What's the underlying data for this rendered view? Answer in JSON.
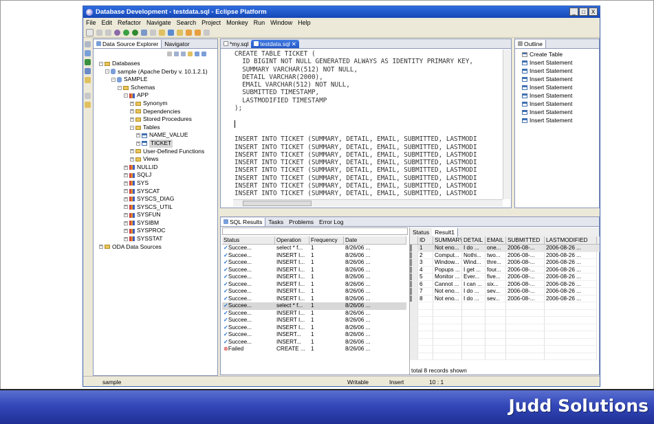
{
  "window": {
    "title": "Database Development - testdata.sql - Eclipse Platform",
    "minimize": "_",
    "maximize": "□",
    "close": "X"
  },
  "menu": [
    "File",
    "Edit",
    "Refactor",
    "Navigate",
    "Search",
    "Project",
    "Monkey",
    "Run",
    "Window",
    "Help"
  ],
  "explorer": {
    "tabs": [
      "Data Source Explorer",
      "Navigator"
    ],
    "nodes": [
      {
        "label": "Databases",
        "level": 0,
        "exp": "-",
        "icon": "folder"
      },
      {
        "label": "sample (Apache Derby v. 10.1.2.1)",
        "level": 1,
        "exp": "-",
        "icon": "db"
      },
      {
        "label": "SAMPLE",
        "level": 2,
        "exp": "-",
        "icon": "db"
      },
      {
        "label": "Schemas",
        "level": 3,
        "exp": "-",
        "icon": "folder"
      },
      {
        "label": "APP",
        "level": 4,
        "exp": "-",
        "icon": "schema"
      },
      {
        "label": "Synonym",
        "level": 5,
        "exp": "+",
        "icon": "folder"
      },
      {
        "label": "Dependencies",
        "level": 5,
        "exp": "+",
        "icon": "folder"
      },
      {
        "label": "Stored Procedures",
        "level": 5,
        "exp": "+",
        "icon": "folder"
      },
      {
        "label": "Tables",
        "level": 5,
        "exp": "-",
        "icon": "folder"
      },
      {
        "label": "NAME_VALUE",
        "level": 6,
        "exp": "+",
        "icon": "table"
      },
      {
        "label": "TICKET",
        "level": 6,
        "exp": "+",
        "icon": "table",
        "selected": true
      },
      {
        "label": "User-Defined Functions",
        "level": 5,
        "exp": "+",
        "icon": "folder"
      },
      {
        "label": "Views",
        "level": 5,
        "exp": "+",
        "icon": "folder"
      },
      {
        "label": "NULLID",
        "level": 4,
        "exp": "+",
        "icon": "schema"
      },
      {
        "label": "SQLJ",
        "level": 4,
        "exp": "+",
        "icon": "schema"
      },
      {
        "label": "SYS",
        "level": 4,
        "exp": "+",
        "icon": "schema"
      },
      {
        "label": "SYSCAT",
        "level": 4,
        "exp": "+",
        "icon": "schema"
      },
      {
        "label": "SYSCS_DIAG",
        "level": 4,
        "exp": "+",
        "icon": "schema"
      },
      {
        "label": "SYSCS_UTIL",
        "level": 4,
        "exp": "+",
        "icon": "schema"
      },
      {
        "label": "SYSFUN",
        "level": 4,
        "exp": "+",
        "icon": "schema"
      },
      {
        "label": "SYSIBM",
        "level": 4,
        "exp": "+",
        "icon": "schema"
      },
      {
        "label": "SYSPROC",
        "level": 4,
        "exp": "+",
        "icon": "schema"
      },
      {
        "label": "SYSSTAT",
        "level": 4,
        "exp": "+",
        "icon": "schema"
      },
      {
        "label": "ODA Data Sources",
        "level": 0,
        "exp": "+",
        "icon": "folder"
      }
    ]
  },
  "editor": {
    "tabs": [
      "*my.sql",
      "testdata.sql"
    ],
    "lines": [
      "CREATE TABLE TICKET (",
      "  ID BIGINT NOT NULL GENERATED ALWAYS AS IDENTITY PRIMARY KEY,",
      "  SUMMARY VARCHAR(512) NOT NULL,",
      "  DETAIL VARCHAR(2000),",
      "  EMAIL VARCHAR(512) NOT NULL,",
      "  SUBMITTED TIMESTAMP,",
      "  LASTMODIFIED TIMESTAMP",
      ");",
      "",
      "",
      "",
      "INSERT INTO TICKET (SUMMARY, DETAIL, EMAIL, SUBMITTED, LASTMODI",
      "INSERT INTO TICKET (SUMMARY, DETAIL, EMAIL, SUBMITTED, LASTMODI",
      "INSERT INTO TICKET (SUMMARY, DETAIL, EMAIL, SUBMITTED, LASTMODI",
      "INSERT INTO TICKET (SUMMARY, DETAIL, EMAIL, SUBMITTED, LASTMODI",
      "INSERT INTO TICKET (SUMMARY, DETAIL, EMAIL, SUBMITTED, LASTMODI",
      "INSERT INTO TICKET (SUMMARY, DETAIL, EMAIL, SUBMITTED, LASTMODI",
      "INSERT INTO TICKET (SUMMARY, DETAIL, EMAIL, SUBMITTED, LASTMODI",
      "INSERT INTO TICKET (SUMMARY, DETAIL, EMAIL, SUBMITTED, LASTMODI"
    ]
  },
  "outline": {
    "tab": "Outline",
    "items": [
      "Create Table",
      "Insert Statement",
      "Insert Statement",
      "Insert Statement",
      "Insert Statement",
      "Insert Statement",
      "Insert Statement",
      "Insert Statement",
      "Insert Statement"
    ]
  },
  "sqlResults": {
    "tabs": [
      "SQL Results",
      "Tasks",
      "Problems",
      "Error Log"
    ],
    "columns": [
      "Status",
      "Operation",
      "Frequency",
      "Date"
    ],
    "rows": [
      {
        "status": "Succee...",
        "op": "select * f...",
        "freq": "1",
        "date": "8/26/06 ...",
        "ok": true
      },
      {
        "status": "Succee...",
        "op": "INSERT I...",
        "freq": "1",
        "date": "8/26/06 ...",
        "ok": true
      },
      {
        "status": "Succee...",
        "op": "INSERT I...",
        "freq": "1",
        "date": "8/26/06 ...",
        "ok": true
      },
      {
        "status": "Succee...",
        "op": "INSERT I...",
        "freq": "1",
        "date": "8/26/06 ...",
        "ok": true
      },
      {
        "status": "Succee...",
        "op": "INSERT I...",
        "freq": "1",
        "date": "8/26/06 ...",
        "ok": true
      },
      {
        "status": "Succee...",
        "op": "INSERT I...",
        "freq": "1",
        "date": "8/26/06 ...",
        "ok": true
      },
      {
        "status": "Succee...",
        "op": "INSERT I...",
        "freq": "1",
        "date": "8/26/06 ...",
        "ok": true
      },
      {
        "status": "Succee...",
        "op": "INSERT I...",
        "freq": "1",
        "date": "8/26/06 ...",
        "ok": true
      },
      {
        "status": "Succee...",
        "op": "select * f...",
        "freq": "1",
        "date": "8/26/06 ...",
        "ok": true,
        "selected": true
      },
      {
        "status": "Succee...",
        "op": "INSERT I...",
        "freq": "1",
        "date": "8/26/06 ...",
        "ok": true
      },
      {
        "status": "Succee...",
        "op": "INSERT I...",
        "freq": "1",
        "date": "8/26/06 ...",
        "ok": true
      },
      {
        "status": "Succee...",
        "op": "INSERT I...",
        "freq": "1",
        "date": "8/26/06 ...",
        "ok": true
      },
      {
        "status": "Succee...",
        "op": "INSERT...",
        "freq": "1",
        "date": "8/26/06 ...",
        "ok": true
      },
      {
        "status": "Succee...",
        "op": "INSERT...",
        "freq": "1",
        "date": "8/26/06 ...",
        "ok": true
      },
      {
        "status": "Failed",
        "op": "CREATE ...",
        "freq": "1",
        "date": "8/26/06 ...",
        "ok": false
      }
    ]
  },
  "result": {
    "tabs": [
      "Status",
      "Result1"
    ],
    "columns": [
      "ID",
      "SUMMARY",
      "DETAIL",
      "EMAIL",
      "SUBMITTED",
      "LASTMODIFIED"
    ],
    "rows": [
      [
        "1",
        "Not eno...",
        "I do ...",
        "one...",
        "2006-08-...",
        "2006-08-26 ..."
      ],
      [
        "2",
        "Comput...",
        "Nothi...",
        "two...",
        "2006-08-...",
        "2006-08-26 ..."
      ],
      [
        "3",
        "Window...",
        "Wind...",
        "thre...",
        "2006-08-...",
        "2006-08-26 ..."
      ],
      [
        "4",
        "Popups ...",
        "I get ...",
        "four...",
        "2006-08-...",
        "2006-08-26 ..."
      ],
      [
        "5",
        "Monitor ...",
        "Ever...",
        "five...",
        "2006-08-...",
        "2006-08-26 ..."
      ],
      [
        "6",
        "Cannot ...",
        "I can ...",
        "six...",
        "2006-08-...",
        "2006-08-26 ..."
      ],
      [
        "7",
        "Not eno...",
        "I do ...",
        "sev...",
        "2006-08-...",
        "2006-08-26 ..."
      ],
      [
        "8",
        "Not eno...",
        "I do ...",
        "sev...",
        "2006-08-...",
        "2006-08-26 ..."
      ]
    ],
    "footer": "total 8 records shown"
  },
  "statusbar": {
    "left": "sample",
    "writable": "Writable",
    "mode": "Insert",
    "position": "10 : 1"
  },
  "brand": "Judd Solutions"
}
